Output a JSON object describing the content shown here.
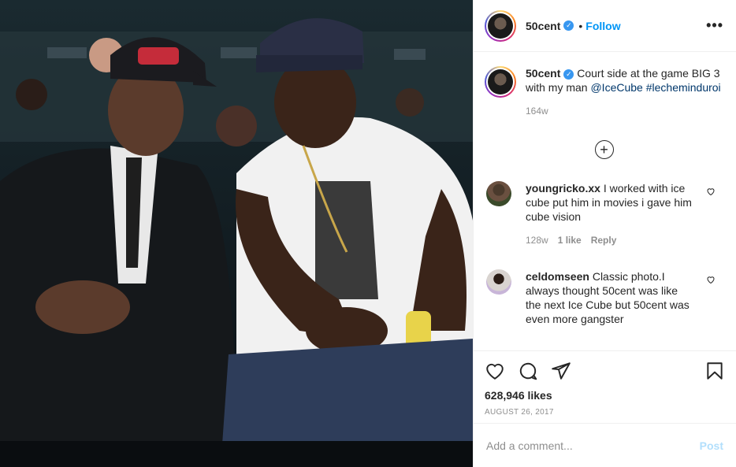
{
  "header": {
    "username": "50cent",
    "follow_label": "Follow",
    "more_label": "•••"
  },
  "caption": {
    "username": "50cent",
    "text": "Court side at the game BIG 3 with my man",
    "mention": "@IceCube",
    "hashtag": "#lecheminduroi",
    "time": "164w"
  },
  "load_more_label": "+",
  "comments": [
    {
      "username": "youngricko.xx",
      "text": "I worked with ice cube put him in movies i gave him cube vision",
      "time": "128w",
      "likes": "1 like",
      "reply_label": "Reply"
    },
    {
      "username": "celdomseen",
      "text": "Classic photo.I always thought 50cent was like the next Ice Cube but 50cent was even more gangster"
    }
  ],
  "actions": {
    "likes": "628,946 likes",
    "date": "AUGUST 26, 2017"
  },
  "add_comment": {
    "placeholder": "Add a comment...",
    "post_label": "Post"
  },
  "colors": {
    "link": "#00376b",
    "follow": "#0095f6",
    "muted": "#8e8e8e",
    "verified": "#3897f0"
  },
  "icons": [
    "verified-icon",
    "more-icon",
    "plus-circle-icon",
    "heart-icon",
    "comment-icon",
    "share-icon",
    "bookmark-icon"
  ]
}
